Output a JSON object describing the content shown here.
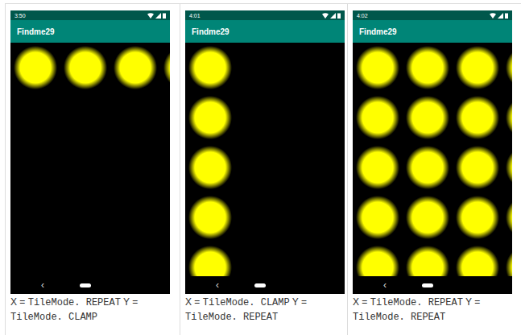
{
  "panels": [
    {
      "status_time": "3:50",
      "title": "Findme29",
      "tile_x": "REPEAT",
      "tile_y": "CLAMP",
      "nav_back": "‹",
      "caption": [
        {
          "text": "X =",
          "kind": "plain"
        },
        {
          "text": "TileMode. REPEAT",
          "kind": "code"
        },
        {
          "text": "Y =",
          "kind": "plain"
        },
        {
          "text": "TileMode. CLAMP",
          "kind": "code"
        }
      ]
    },
    {
      "status_time": "4:01",
      "title": "Findme29",
      "tile_x": "CLAMP",
      "tile_y": "REPEAT",
      "nav_back": "‹",
      "caption": [
        {
          "text": "X =",
          "kind": "plain"
        },
        {
          "text": "TileMode. CLAMP",
          "kind": "code"
        },
        {
          "text": "Y =",
          "kind": "plain"
        },
        {
          "text": "TileMode. REPEAT",
          "kind": "code"
        }
      ]
    },
    {
      "status_time": "4:02",
      "title": "Findme29",
      "tile_x": "REPEAT",
      "tile_y": "REPEAT",
      "nav_back": "‹",
      "caption": [
        {
          "text": "X =",
          "kind": "plain"
        },
        {
          "text": "TileMode. REPEAT",
          "kind": "code"
        },
        {
          "text": "Y =",
          "kind": "plain"
        },
        {
          "text": "TileMode. REPEAT",
          "kind": "code"
        }
      ]
    }
  ]
}
